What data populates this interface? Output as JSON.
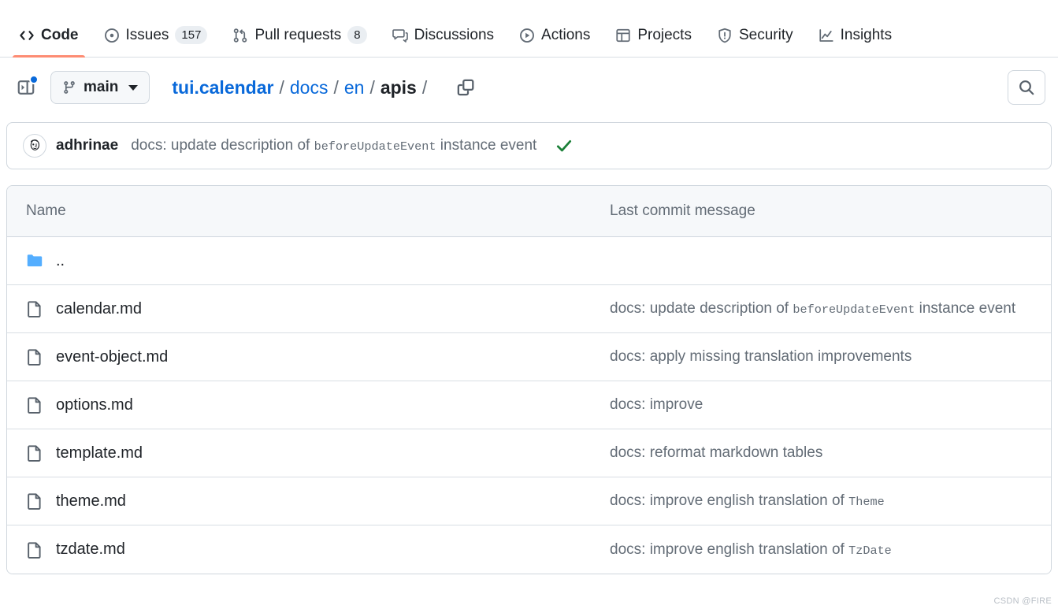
{
  "nav": {
    "tabs": [
      {
        "label": "Code",
        "icon": "code-icon",
        "count": null,
        "selected": true
      },
      {
        "label": "Issues",
        "icon": "issue-opened-icon",
        "count": "157",
        "selected": false
      },
      {
        "label": "Pull requests",
        "icon": "git-pull-request-icon",
        "count": "8",
        "selected": false
      },
      {
        "label": "Discussions",
        "icon": "comment-discussion-icon",
        "count": null,
        "selected": false
      },
      {
        "label": "Actions",
        "icon": "play-icon",
        "count": null,
        "selected": false
      },
      {
        "label": "Projects",
        "icon": "table-icon",
        "count": null,
        "selected": false
      },
      {
        "label": "Security",
        "icon": "shield-icon",
        "count": null,
        "selected": false
      },
      {
        "label": "Insights",
        "icon": "graph-icon",
        "count": null,
        "selected": false
      }
    ],
    "selected_underline_color": "#fd8c73"
  },
  "toolbar": {
    "sidebar_toggle_icon": "sidebar-expand-icon",
    "notification_dot_color": "#0969da",
    "branch": {
      "name": "main",
      "icon": "git-branch-icon",
      "caret_icon": "chevron-down-icon"
    },
    "breadcrumb": {
      "root": "tui.calendar",
      "segments": [
        "docs",
        "en",
        "apis"
      ],
      "separator": "/",
      "trailing_separator": "/"
    },
    "copy_path_icon": "copy-icon",
    "search_icon": "search-icon"
  },
  "commit_bar": {
    "author": "adhrinae",
    "avatar_icon": "user-avatar",
    "message_prefix": "docs: update description of ",
    "message_code": "beforeUpdateEvent",
    "message_suffix": " instance event",
    "status_icon": "check-icon",
    "status_color": "#1a7f37"
  },
  "file_table": {
    "headers": {
      "name": "Name",
      "message": "Last commit message"
    },
    "rows": [
      {
        "name": "..",
        "icon": "folder-icon",
        "type": "parent-directory",
        "message_prefix": "",
        "message_code": "",
        "message_suffix": ""
      },
      {
        "name": "calendar.md",
        "icon": "file-icon",
        "type": "file",
        "message_prefix": "docs: update description of ",
        "message_code": "beforeUpdateEvent",
        "message_suffix": " instance event"
      },
      {
        "name": "event-object.md",
        "icon": "file-icon",
        "type": "file",
        "message_prefix": "docs: apply missing translation improvements",
        "message_code": "",
        "message_suffix": ""
      },
      {
        "name": "options.md",
        "icon": "file-icon",
        "type": "file",
        "message_prefix": "docs: improve",
        "message_code": "",
        "message_suffix": ""
      },
      {
        "name": "template.md",
        "icon": "file-icon",
        "type": "file",
        "message_prefix": "docs: reformat markdown tables",
        "message_code": "",
        "message_suffix": ""
      },
      {
        "name": "theme.md",
        "icon": "file-icon",
        "type": "file",
        "message_prefix": "docs: improve english translation of ",
        "message_code": "Theme",
        "message_suffix": ""
      },
      {
        "name": "tzdate.md",
        "icon": "file-icon",
        "type": "file",
        "message_prefix": "docs: improve english translation of ",
        "message_code": "TzDate",
        "message_suffix": ""
      }
    ]
  },
  "watermark": {
    "text": "CSDN @FIRE"
  }
}
